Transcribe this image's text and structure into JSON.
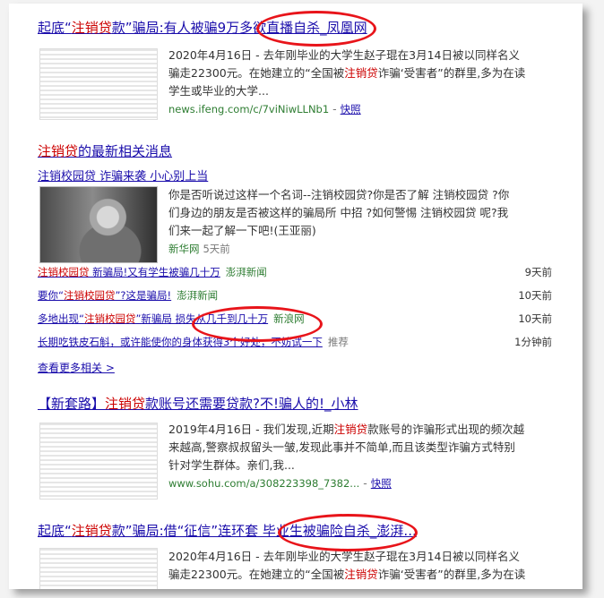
{
  "result1": {
    "title_pre": "起底“",
    "title_red": "注销贷",
    "title_post": "款”骗局:有人被骗9万多欲直播自杀_凤凰网",
    "snippet_line1": "2020年4月16日 - 去年刚毕业的大学生赵子琨在3月14日被以同样名义",
    "snippet_line2_pre": "骗走22300元。在她建立的“全国被",
    "snippet_line2_red": "注销贷",
    "snippet_line2_post": "诈骗‘受害者”的群里,多为在读",
    "snippet_line3": "学生或毕业的大学...",
    "url": "news.ifeng.com/c/7viNiwLLNb1",
    "sep": "-",
    "cache": "快照"
  },
  "news": {
    "heading_red": "注销贷",
    "heading_post": "的最新相关消息",
    "top_title": "注销校园贷 诈骗来袭 小心别上当",
    "top_snippet_line1": "你是否听说过这样一个名词--注销校园贷?你是否了解 注销校园贷 ?你",
    "top_snippet_line2": "们身边的朋友是否被这样的骗局所 中招 ?如何警惕 注销校园贷 呢?我",
    "top_snippet_line3": "们来一起了解一下吧!(王亚丽)",
    "top_source": "新华网",
    "top_time": "5天前",
    "rows": [
      {
        "pre": "",
        "red": "注销校园贷",
        "post": " 新骗局!又有学生被骗几十万",
        "source": "澎湃新闻",
        "time": "9天前"
      },
      {
        "pre": "要你“",
        "red": "注销校园贷",
        "post": "”?这是骗局!",
        "source": "澎湃新闻",
        "time": "10天前"
      },
      {
        "pre": "多地出现“",
        "red": "注销校园贷",
        "post": "”新骗局 损失从几千到几十万",
        "source": "新浪网",
        "time": "10天前"
      },
      {
        "pre": "",
        "red": "",
        "post": "长期吃铁皮石斛，或许能使你的身体获得3个好处，不妨试一下",
        "source": "推荐",
        "time": "1分钟前"
      }
    ],
    "more": "查看更多相关 >"
  },
  "result2": {
    "title_pre": "【新套路】",
    "title_red": "注销贷",
    "title_post": "款账号还需要贷款?不!骗人的!_小林",
    "snippet_line1_pre": "2019年4月16日 - 我们发现,近期",
    "snippet_line1_red": "注销贷",
    "snippet_line1_post": "款账号的诈骗形式出现的频次越",
    "snippet_line2": "来越高,警察叔叔留头一皱,发现此事并不简单,而且该类型诈骗方式特别",
    "snippet_line3": "针对学生群体。亲们,我...",
    "url": "www.sohu.com/a/308223398_7382...",
    "sep": "-",
    "cache": "快照"
  },
  "result3": {
    "title_pre": "起底“",
    "title_red": "注销贷",
    "title_post": "款”骗局:借“征信”连环套 毕业生被骗险自杀_澎湃...",
    "snippet_line1": "2020年4月16日 - 去年刚毕业的大学生赵子琨在3月14日被以同样名义",
    "snippet_line2_pre": "骗走22300元。在她建立的“全国被",
    "snippet_line2_red": "注销贷",
    "snippet_line2_post": "诈骗‘受害者”的群里,多为在读"
  }
}
